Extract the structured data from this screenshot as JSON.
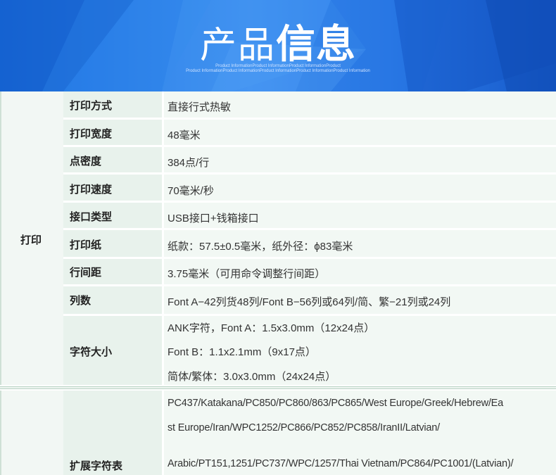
{
  "banner": {
    "title_light": "产品",
    "title_bold": "信息",
    "subtitle_line1": "Product InformationProduct InformationProduct InformationProduct",
    "subtitle_line2": "Product InformationProduct InformationProduct InformationProduct InformationProduct Information"
  },
  "groups": [
    {
      "label": "打印"
    },
    {
      "label": ""
    }
  ],
  "rows": [
    {
      "label": "打印方式",
      "value": "直接行式热敏"
    },
    {
      "label": "打印宽度",
      "value": "48毫米"
    },
    {
      "label": "点密度",
      "value": "384点/行"
    },
    {
      "label": "打印速度",
      "value": "70毫米/秒"
    },
    {
      "label": "接口类型",
      "value": "USB接口+钱箱接口"
    },
    {
      "label": "打印纸",
      "value": "纸款：57.5±0.5毫米，纸外径：ϕ83毫米"
    },
    {
      "label": "行间距",
      "value": "3.75毫米（可用命令调整行间距）"
    },
    {
      "label": "列数",
      "value": "Font A−42列货48列/Font B−56列或64列/简、繁−21列或24列"
    },
    {
      "label": "字符大小",
      "values": [
        "ANK字符，Font A：1.5x3.0mm（12x24点）",
        "Font B：1.1x2.1mm（9x17点）",
        "简体/繁体：3.0x3.0mm（24x24点）"
      ]
    },
    {
      "label": "扩展字符表",
      "values": [
        "PC437/Katakana/PC850/PC860/863/PC865/West Europe/Greek/Hebrew/Ea",
        "st Europe/Iran/WPC1252/PC866/PC852/PC858/IranII/Latvian/",
        "Arabic/PT151,1251/PC737/WPC/1257/Thai Vietnam/PC864/PC1001/(Latvian)/"
      ]
    }
  ]
}
